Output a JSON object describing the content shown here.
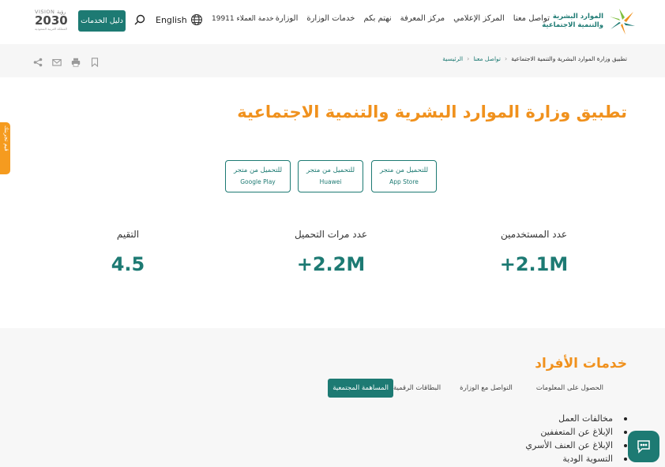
{
  "header": {
    "logo_line1": "الموارد البشرية",
    "logo_line2": "والتنمية الاجتماعية",
    "nav": [
      "الوزارة",
      "خدمات الوزارة",
      "نهتم بكم",
      "مركز المعرفة",
      "المركز الإعلامي",
      "تواصل معنا"
    ],
    "service_center": "خدمة العملاء 19911",
    "language": "English",
    "guide_button": "دليل الخدمات",
    "vision_top": "VISION رؤية",
    "vision_year": "2030",
    "vision_sub": "المملكة العربية السعودية"
  },
  "breadcrumb": {
    "home": "الرئيسية",
    "parent": "تواصل معنا",
    "current": "تطبيق وزارة الموارد البشرية والتنمية الاجتماعية"
  },
  "feedback_label": "قيم تجربتك",
  "page_title": "تطبيق وزارة الموارد البشرية والتنمية الاجتماعية",
  "stores": [
    {
      "line1": "للتحميل من متجر",
      "line2": "App Store"
    },
    {
      "line1": "للتحميل من متجر",
      "line2": "Huawei"
    },
    {
      "line1": "للتحميل من متجر",
      "line2": "Google Play"
    }
  ],
  "stats": [
    {
      "label": "عدد المستخدمين",
      "value": "+2.1M"
    },
    {
      "label": "عدد مرات التحميل",
      "value": "+2.2M"
    },
    {
      "label": "التقيم",
      "value": "4.5"
    }
  ],
  "services": {
    "title": "خدمات الأفراد",
    "tabs": [
      "المساهمة المجتمعية",
      "البطاقات الرقمية",
      "التواصل مع الوزارة",
      "الحصول على المعلومات"
    ],
    "active_tab": "المساهمة المجتمعية",
    "items": [
      "مخالفات العمل",
      "الإبلاغ عن المتعففين",
      "الإبلاغ عن العنف الأسري",
      "التسوية الودية"
    ]
  },
  "colors": {
    "brand_teal": "#1d7a73",
    "accent_orange": "#f0911d",
    "feedback_orange": "#f59b1f"
  },
  "icons": [
    "ministry-logo-icon",
    "globe-icon",
    "search-icon",
    "share-icon",
    "mail-icon",
    "print-icon",
    "bookmark-icon",
    "chat-icon"
  ]
}
